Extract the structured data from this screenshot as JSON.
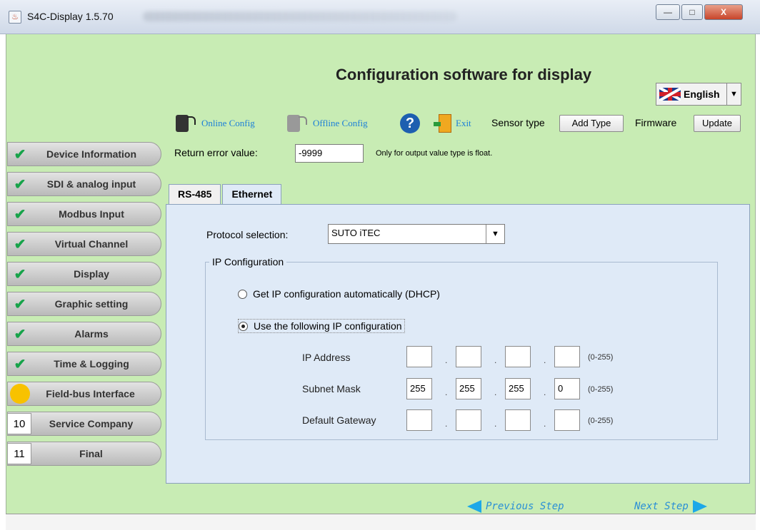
{
  "window": {
    "title": "S4C-Display 1.5.70",
    "minimize": "—",
    "maximize": "□",
    "close": "X"
  },
  "header": {
    "title": "Configuration software for display",
    "language": "English"
  },
  "toolbar": {
    "online_config": "Online Config",
    "offline_config": "Offline Config",
    "exit": "Exit",
    "sensor_type_label": "Sensor type",
    "add_type": "Add Type",
    "firmware_label": "Firmware",
    "update": "Update"
  },
  "sidebar": {
    "items": [
      {
        "marker": "✔",
        "label": "Device Information"
      },
      {
        "marker": "✔",
        "label": "SDI & analog input"
      },
      {
        "marker": "✔",
        "label": "Modbus Input"
      },
      {
        "marker": "✔",
        "label": "Virtual Channel"
      },
      {
        "marker": "✔",
        "label": "Display"
      },
      {
        "marker": "✔",
        "label": "Graphic setting"
      },
      {
        "marker": "✔",
        "label": "Alarms"
      },
      {
        "marker": "✔",
        "label": "Time & Logging"
      },
      {
        "marker": "",
        "label": "Field-bus Interface"
      },
      {
        "marker": "10",
        "label": "Service Company"
      },
      {
        "marker": "11",
        "label": "Final"
      }
    ]
  },
  "main": {
    "return_error_label": "Return error value:",
    "return_error_value": "-9999",
    "return_error_hint": "Only for output value type is float.",
    "tabs": [
      "RS-485",
      "Ethernet"
    ],
    "protocol_label": "Protocol selection:",
    "protocol_value": "SUTO iTEC",
    "ip_group_title": "IP Configuration",
    "radio_dhcp": "Get IP configuration automatically (DHCP)",
    "radio_manual": "Use the following IP configuration",
    "ip_address_label": "IP Address",
    "subnet_mask_label": "Subnet Mask",
    "gateway_label": "Default Gateway",
    "ip_address": [
      "",
      "",
      "",
      ""
    ],
    "subnet_mask": [
      "255",
      "255",
      "255",
      "0"
    ],
    "gateway": [
      "",
      "",
      "",
      ""
    ],
    "range_hint": "(0-255)",
    "dot": "."
  },
  "nav": {
    "previous": "Previous Step",
    "next": "Next Step"
  }
}
